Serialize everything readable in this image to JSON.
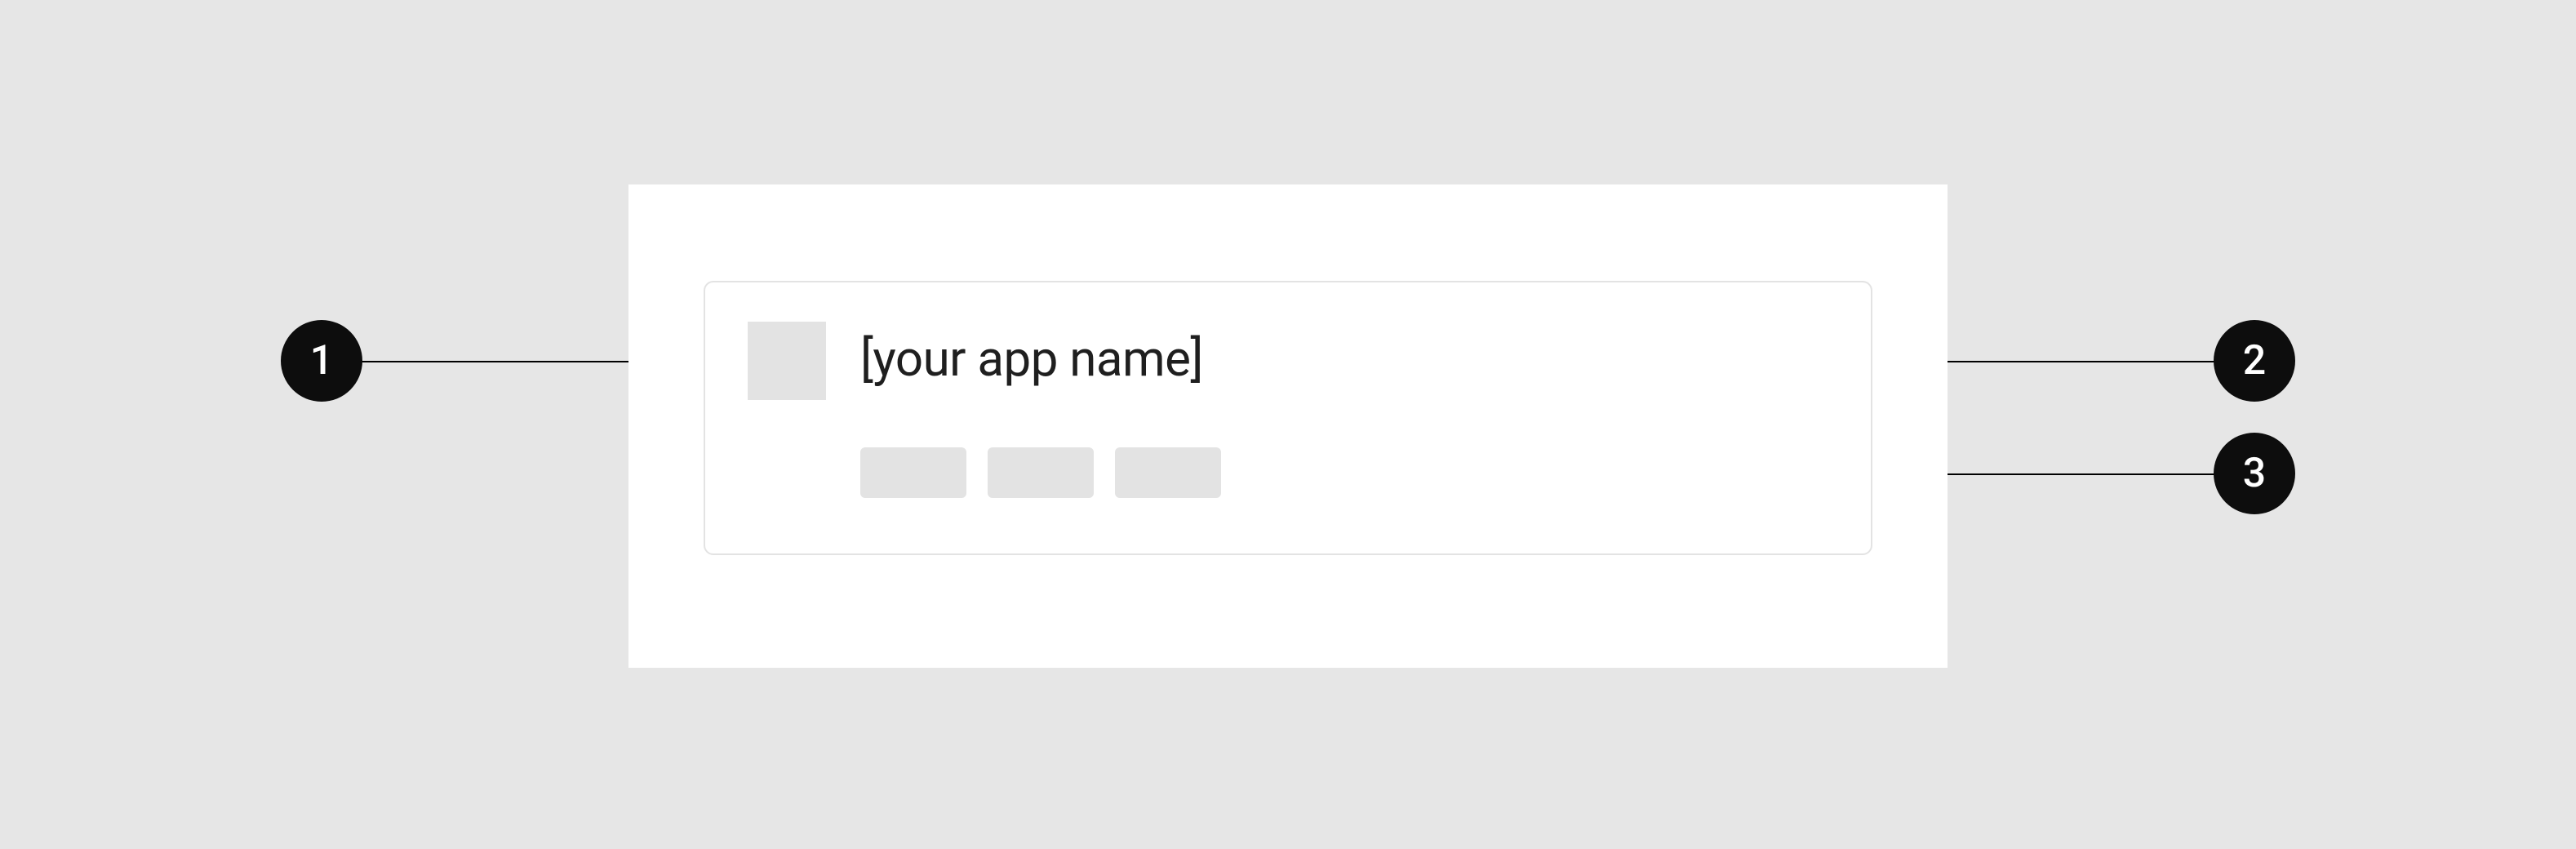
{
  "diagram": {
    "app_name_placeholder": "[your app name]",
    "callouts": {
      "icon": {
        "number": "1"
      },
      "title": {
        "number": "2"
      },
      "meta": {
        "number": "3"
      }
    }
  }
}
